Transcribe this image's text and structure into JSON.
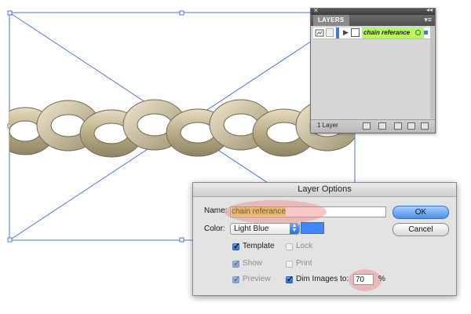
{
  "layers_panel": {
    "tab_label": "LAYERS",
    "layer_name": "chain referance",
    "layer_count": "1 Layer",
    "layer_color": "#3d7fd6",
    "row_highlight": "#b9f565"
  },
  "dialog": {
    "title": "Layer Options",
    "name_label": "Name:",
    "name_value": "chain referance",
    "color_label": "Color:",
    "color_value": "Light Blue",
    "swatch_color": "#3f86ff",
    "template_label": "Template",
    "template_checked": true,
    "lock_label": "Lock",
    "lock_checked": false,
    "show_label": "Show",
    "show_checked": true,
    "print_label": "Print",
    "print_checked": false,
    "preview_label": "Preview",
    "preview_checked": true,
    "dim_label": "Dim Images to:",
    "dim_checked": true,
    "dim_value": "70",
    "percent_sign": "%",
    "ok_label": "OK",
    "cancel_label": "Cancel"
  }
}
